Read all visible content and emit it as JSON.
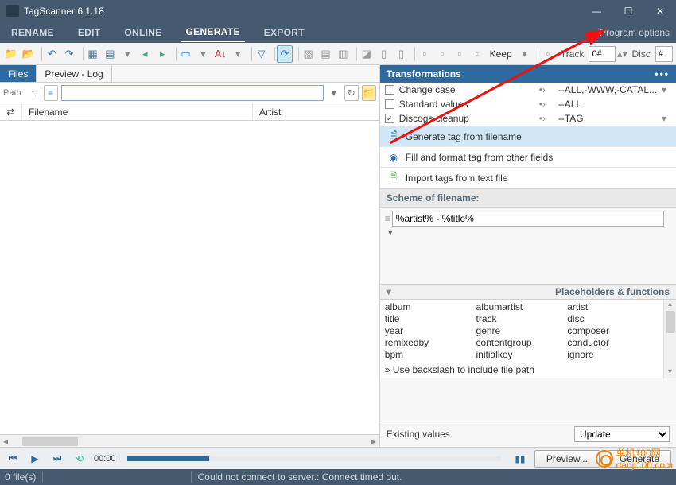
{
  "window": {
    "title": "TagScanner 6.1.18"
  },
  "menu": {
    "items": [
      "RENAME",
      "EDIT",
      "ONLINE",
      "GENERATE",
      "EXPORT"
    ],
    "active": 3,
    "program_options": "Program options"
  },
  "toolbar": {
    "keep_label": "Keep",
    "track_label": "Track",
    "track_value": "0#",
    "disc_label": "Disc",
    "disc_value": "#"
  },
  "left": {
    "tabs": {
      "files": "Files",
      "preview": "Preview - Log"
    },
    "path_label": "Path",
    "path_value": "",
    "columns": {
      "shuffle": "⇄",
      "filename": "Filename",
      "artist": "Artist"
    }
  },
  "right": {
    "transformations_hdr": "Transformations",
    "transforms": [
      {
        "checked": false,
        "name": "Change case",
        "value": "--ALL,-WWW,-CATAL..."
      },
      {
        "checked": false,
        "name": "Standard values",
        "value": "--ALL"
      },
      {
        "checked": true,
        "name": "Discogs cleanup",
        "value": "--TAG"
      }
    ],
    "actions": [
      {
        "label": "Generate tag from filename",
        "active": true
      },
      {
        "label": "Fill and format tag from other fields",
        "active": false
      },
      {
        "label": "Import tags from text file",
        "active": false
      }
    ],
    "scheme_hdr": "Scheme of filename:",
    "scheme_value": "%artist% - %title%",
    "placeholders_hdr": "Placeholders & functions",
    "placeholders": {
      "col1": [
        "album",
        "title",
        "year",
        "remixedby",
        "bpm"
      ],
      "col2": [
        "albumartist",
        "track",
        "genre",
        "contentgroup",
        "initialkey"
      ],
      "col3": [
        "artist",
        "disc",
        "composer",
        "conductor",
        "ignore"
      ]
    },
    "placeholders_note": "» Use backslash to include file path",
    "existing_label": "Existing values",
    "existing_value": "Update",
    "preview_btn": "Preview...",
    "generate_btn": "Generate"
  },
  "player": {
    "time": "00:00"
  },
  "status": {
    "files": "0 file(s)",
    "msg": "Could not connect to server.: Connect timed out."
  },
  "watermark": "单机100网\ndanji100.com"
}
